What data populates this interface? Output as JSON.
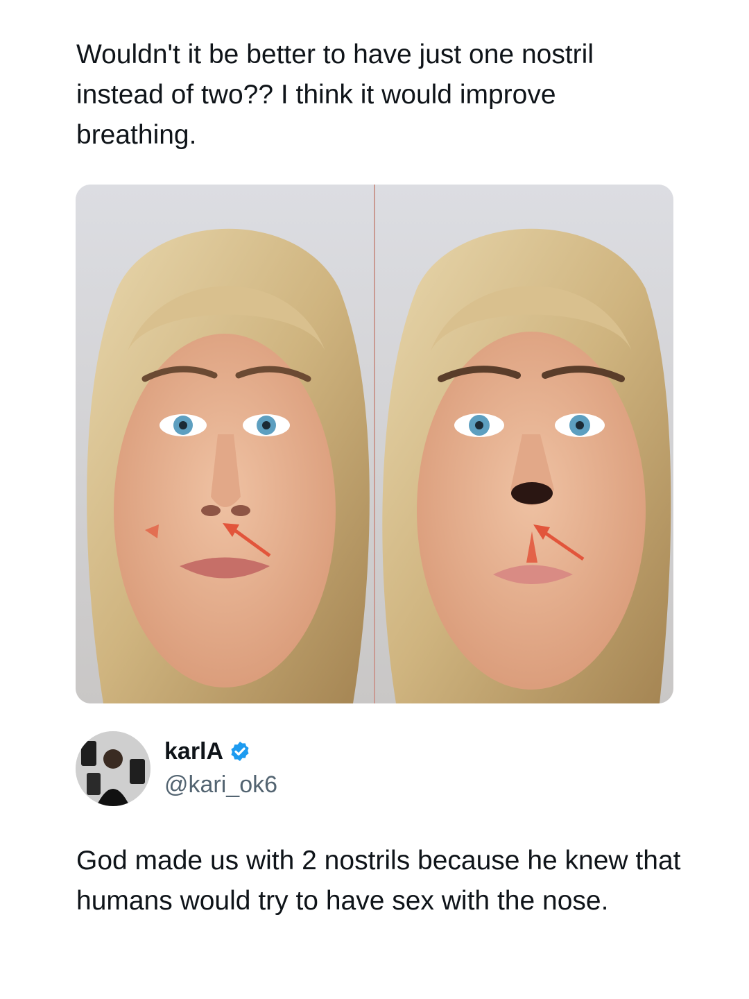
{
  "post": {
    "text": "Wouldn't it be better to have just one nostril instead of two?? I think it would improve breathing."
  },
  "reply_card": {
    "author": {
      "display_name": "karlA",
      "handle": "@kari_ok6",
      "verified_icon": "verified-badge-icon"
    },
    "text": "God made us with 2 nostrils because he knew that humans would try to have sex with the nose."
  },
  "colors": {
    "text": "#0f1419",
    "secondary_text": "#536471",
    "verified": "#1d9bf0",
    "arrow_annotation": "#e2553b"
  }
}
